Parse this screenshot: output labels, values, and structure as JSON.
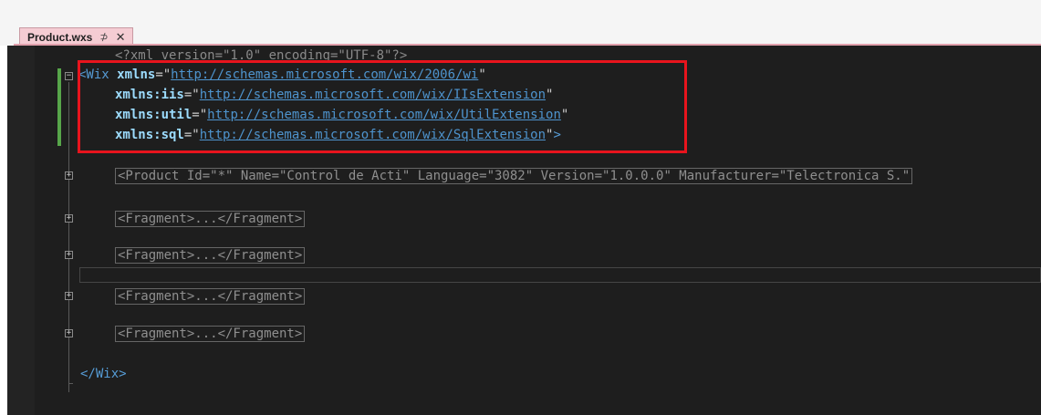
{
  "tab": {
    "title": "Product.wxs",
    "pin_glyph": "⊅",
    "close_glyph": "✕"
  },
  "code": {
    "xml_decl": "<?xml version=\"1.0\" encoding=\"UTF-8\"?>",
    "wix_open": "<Wix",
    "ns_default_attr": "xmlns",
    "ns_default_url": "http://schemas.microsoft.com/wix/2006/wi",
    "ns_iis_attr": "xmlns:iis",
    "ns_iis_url": "http://schemas.microsoft.com/wix/IIsExtension",
    "ns_util_attr": "xmlns:util",
    "ns_util_url": "http://schemas.microsoft.com/wix/UtilExtension",
    "ns_sql_attr": "xmlns:sql",
    "ns_sql_url": "http://schemas.microsoft.com/wix/SqlExtension",
    "close_bracket": ">",
    "product_collapsed": "<Product Id=\"*\" Name=\"Control de Acti\" Language=\"3082\" Version=\"1.0.0.0\" Manufacturer=\"Telectronica S.\"",
    "fragment_collapsed": "<Fragment>...</Fragment>",
    "wix_close": "</Wix>"
  },
  "fold_glyphs": {
    "expanded": "−",
    "collapsed": "+"
  },
  "colors": {
    "highlight_box": "#e8141d",
    "change_bar": "#57a64a",
    "tab_accent": "#f5ccd3"
  }
}
